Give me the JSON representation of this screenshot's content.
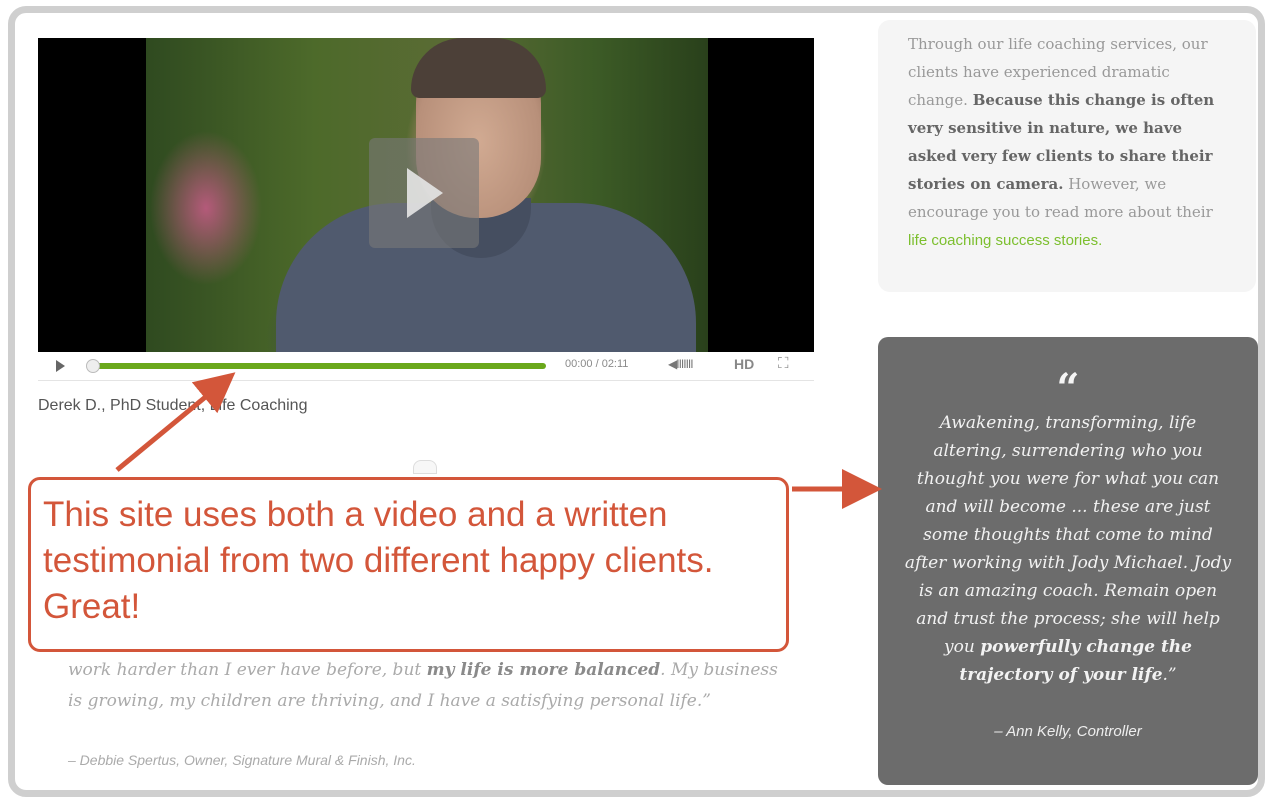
{
  "video": {
    "time_display": "00:00 / 02:11",
    "volume_glyph": "◀IIIIIII",
    "hd_label": "HD",
    "fullscreen_glyph": "⛶",
    "progress_fraction": 0.0,
    "caption": "Derek D., PhD Student, Life Coaching"
  },
  "intro": {
    "part1": "Through our life coaching services, our clients have experienced dramatic change. ",
    "bold": "Because this change is often very sensitive in nature, we have asked very few clients to share their stories on camera.",
    "part2": " However, we encourage you to read more about their ",
    "link": "life coaching success stories."
  },
  "quote": {
    "mark": "“",
    "text": "Awakening, transforming, life altering, surrendering who you thought you were for what you can and will become ... these are just some thoughts that come to mind after working with Jody Michael. Jody is an amazing coach. Remain open and trust the process; she will help you ",
    "bold": "powerfully change the trajectory of your life",
    "end": ".”",
    "attribution": "– Ann Kelly, Controller"
  },
  "bottom_quote": {
    "part1": "work harder than I ever have before, but ",
    "bold": "my life is more balanced",
    "part2": ". My business is growing, my children are thriving, and I have a satisfying personal life.”",
    "attribution": "– Debbie Spertus, Owner, Signature Mural & Finish, Inc."
  },
  "callout": {
    "text": "This site uses both a video and a written testimonial from two different happy clients. Great!"
  },
  "colors": {
    "annotation": "#d3563a",
    "link": "#7cbf2e",
    "progress": "#6aa81b",
    "quote_box": "#6c6c6c"
  }
}
